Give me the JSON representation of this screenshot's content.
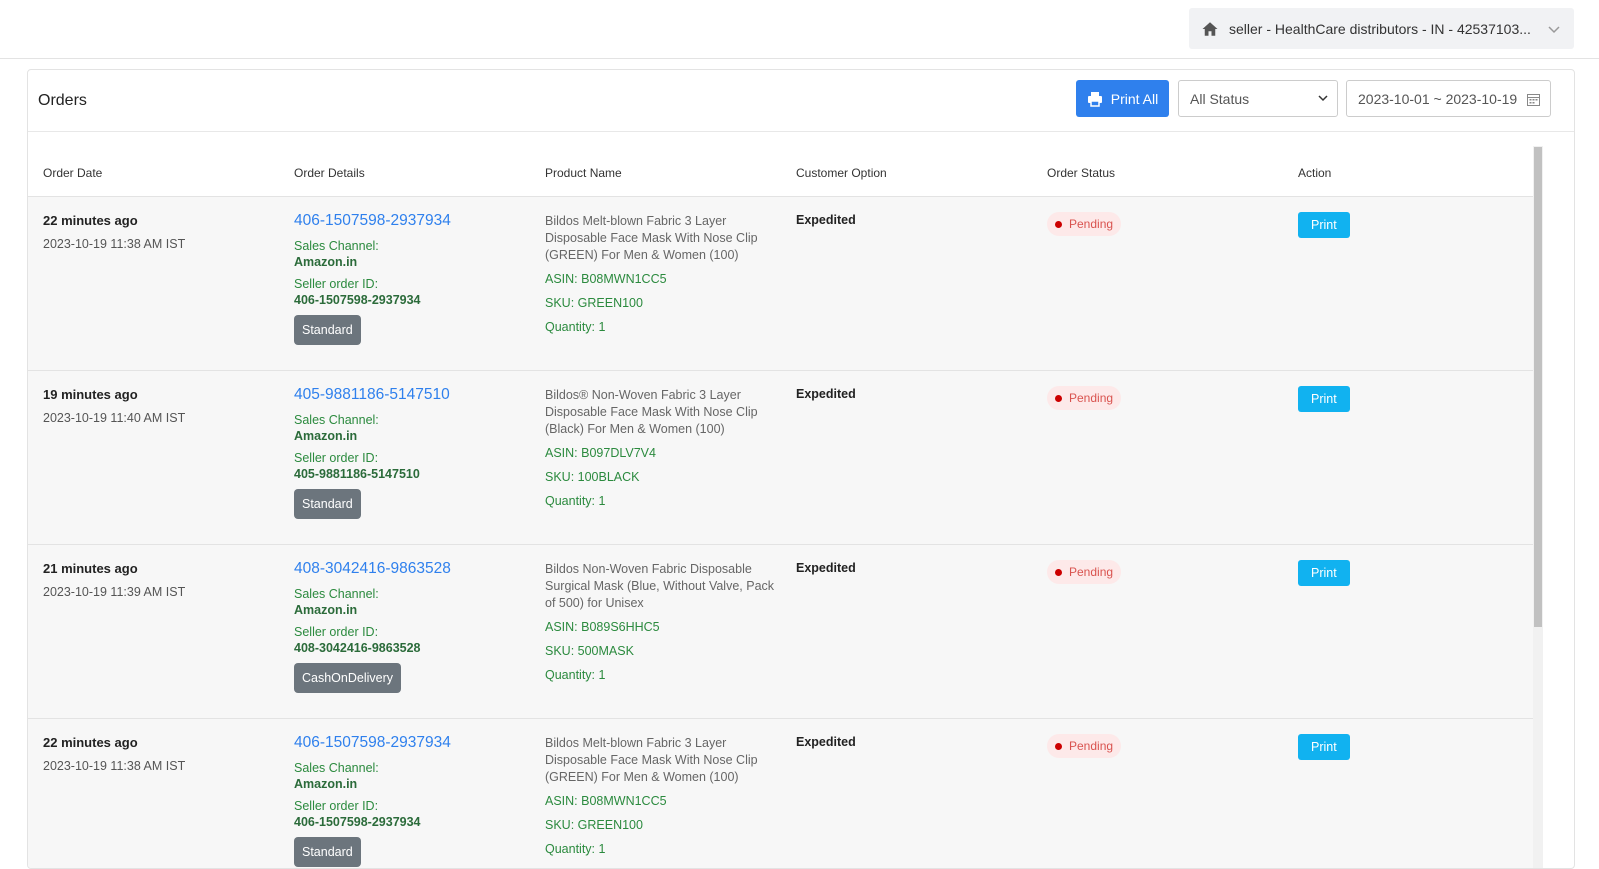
{
  "topbar": {
    "account_label": "seller - HealthCare distributors - IN - 42537103..."
  },
  "panel": {
    "title": "Orders",
    "print_all_label": "Print All",
    "status_filter": "All Status",
    "date_range": "2023-10-01 ~ 2023-10-19"
  },
  "table": {
    "headers": [
      "Order Date",
      "Order Details",
      "Product Name",
      "Customer Option",
      "Order Status",
      "Action"
    ],
    "rows": [
      {
        "relative_time": "22 minutes ago",
        "datetime": "2023-10-19 11:38 AM IST",
        "order_id": "406-1507598-2937934",
        "sales_channel_label": "Sales Channel:",
        "sales_channel": "Amazon.in",
        "seller_order_label": "Seller order ID:",
        "seller_order_id": "406-1507598-2937934",
        "fulfillment": "Standard",
        "product_name": "Bildos Melt-blown Fabric 3 Layer Disposable Face Mask With Nose Clip (GREEN) For Men & Women (100)",
        "asin": "ASIN: B08MWN1CC5",
        "sku": "SKU: GREEN100",
        "quantity": "Quantity: 1",
        "customer_option": "Expedited",
        "status": "Pending",
        "action": "Print"
      },
      {
        "relative_time": "19 minutes ago",
        "datetime": "2023-10-19 11:40 AM IST",
        "order_id": "405-9881186-5147510",
        "sales_channel_label": "Sales Channel:",
        "sales_channel": "Amazon.in",
        "seller_order_label": "Seller order ID:",
        "seller_order_id": "405-9881186-5147510",
        "fulfillment": "Standard",
        "product_name": "Bildos® Non-Woven Fabric 3 Layer Disposable Face Mask With Nose Clip (Black) For Men & Women (100)",
        "asin": "ASIN: B097DLV7V4",
        "sku": "SKU: 100BLACK",
        "quantity": "Quantity: 1",
        "customer_option": "Expedited",
        "status": "Pending",
        "action": "Print"
      },
      {
        "relative_time": "21 minutes ago",
        "datetime": "2023-10-19 11:39 AM IST",
        "order_id": "408-3042416-9863528",
        "sales_channel_label": "Sales Channel:",
        "sales_channel": "Amazon.in",
        "seller_order_label": "Seller order ID:",
        "seller_order_id": "408-3042416-9863528",
        "fulfillment": "CashOnDelivery",
        "product_name": "Bildos Non-Woven Fabric Disposable Surgical Mask (Blue, Without Valve, Pack of 500) for Unisex",
        "asin": "ASIN: B089S6HHC5",
        "sku": "SKU: 500MASK",
        "quantity": "Quantity: 1",
        "customer_option": "Expedited",
        "status": "Pending",
        "action": "Print"
      },
      {
        "relative_time": "22 minutes ago",
        "datetime": "2023-10-19 11:38 AM IST",
        "order_id": "406-1507598-2937934",
        "sales_channel_label": "Sales Channel:",
        "sales_channel": "Amazon.in",
        "seller_order_label": "Seller order ID:",
        "seller_order_id": "406-1507598-2937934",
        "fulfillment": "Standard",
        "product_name": "Bildos Melt-blown Fabric 3 Layer Disposable Face Mask With Nose Clip (GREEN) For Men & Women (100)",
        "asin": "ASIN: B08MWN1CC5",
        "sku": "SKU: GREEN100",
        "quantity": "Quantity: 1",
        "customer_option": "Expedited",
        "status": "Pending",
        "action": "Print"
      }
    ]
  },
  "colors": {
    "primary": "#2f80ed",
    "print_button": "#11b2f0",
    "green_text": "#2b8a3e",
    "pending_bg": "#fde9e9",
    "pending_text": "#d9534f"
  }
}
